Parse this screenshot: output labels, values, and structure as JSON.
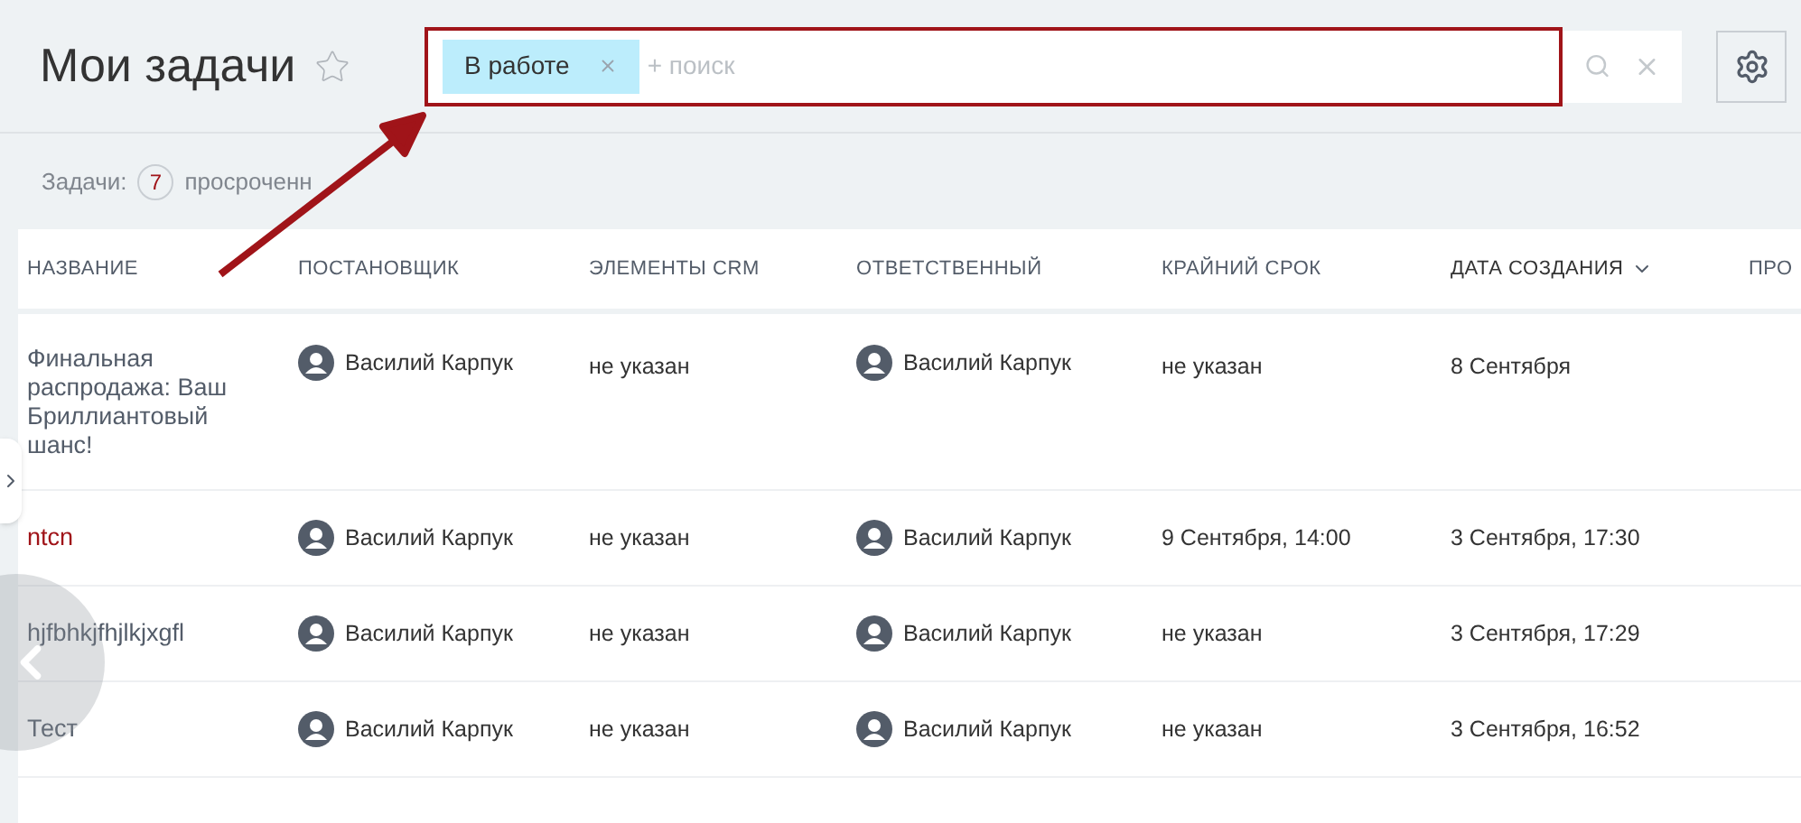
{
  "title": "Мои задачи",
  "search": {
    "filter_tag": "В работе",
    "placeholder": "+ поиск"
  },
  "counters": {
    "label": "Задачи:",
    "count": "7",
    "overdue_label": "просроченн"
  },
  "table": {
    "columns": [
      {
        "label": "НАЗВАНИЕ",
        "sorted": false
      },
      {
        "label": "ПОСТАНОВЩИК",
        "sorted": false
      },
      {
        "label": "ЭЛЕМЕНТЫ CRM",
        "sorted": false
      },
      {
        "label": "ОТВЕТСТВЕННЫЙ",
        "sorted": false
      },
      {
        "label": "КРАЙНИЙ СРОК",
        "sorted": false
      },
      {
        "label": "ДАТА СОЗДАНИЯ",
        "sorted": true
      },
      {
        "label": "ПРО",
        "sorted": false
      }
    ],
    "rows": [
      {
        "name": "Финальная распродажа: Ваш Бриллиантовый шанс!",
        "overdue": false,
        "creator": "Василий Карпук",
        "crm": "не указан",
        "responsible": "Василий Карпук",
        "deadline": "не указан",
        "created": "8 Сентября"
      },
      {
        "name": "ntcn",
        "overdue": true,
        "creator": "Василий Карпук",
        "crm": "не указан",
        "responsible": "Василий Карпук",
        "deadline": "9 Сентября, 14:00",
        "created": "3 Сентября, 17:30"
      },
      {
        "name": "hjfbhkjfhjlkjxgfl",
        "overdue": false,
        "creator": "Василий Карпук",
        "crm": "не указан",
        "responsible": "Василий Карпук",
        "deadline": "не указан",
        "created": "3 Сентября, 17:29"
      },
      {
        "name": "Тест",
        "overdue": false,
        "creator": "Василий Карпук",
        "crm": "не указан",
        "responsible": "Василий Карпук",
        "deadline": "не указан",
        "created": "3 Сентября, 16:52"
      }
    ]
  }
}
